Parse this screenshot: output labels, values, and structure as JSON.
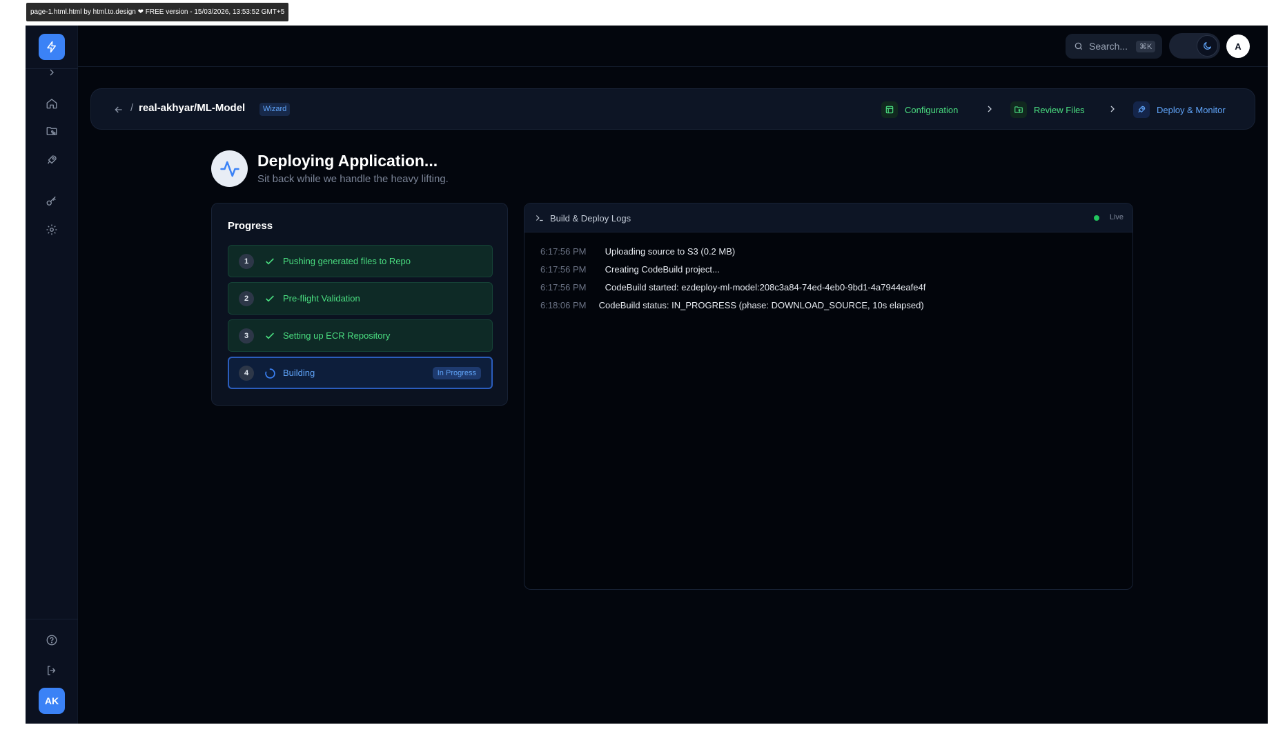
{
  "watermark": "page-1.html.html by html.to.design ❤ FREE version - 15/03/2026, 13:53:52 GMT+5",
  "topbar": {
    "search_placeholder": "Search...",
    "search_shortcut": "⌘K",
    "user_initial": "A"
  },
  "sidebar": {
    "items": [
      {
        "name": "expand",
        "icon": "chevron-right-icon"
      },
      {
        "name": "home",
        "icon": "home-icon"
      },
      {
        "name": "repositories",
        "icon": "folder-git-icon"
      },
      {
        "name": "deployments",
        "icon": "rocket-icon"
      },
      {
        "name": "keys",
        "icon": "key-icon"
      },
      {
        "name": "settings",
        "icon": "gear-icon"
      },
      {
        "name": "help",
        "icon": "help-circle-icon"
      },
      {
        "name": "logout",
        "icon": "logout-icon"
      }
    ],
    "avatar_initials": "AK"
  },
  "wizard": {
    "slash": "/",
    "repo": "real-akhyar/ML-Model",
    "badge": "Wizard",
    "steps": [
      {
        "label": "Configuration",
        "icon": "layout-icon",
        "state": "done"
      },
      {
        "label": "Review Files",
        "icon": "folder-git-icon",
        "state": "done"
      },
      {
        "label": "Deploy & Monitor",
        "icon": "rocket-icon",
        "state": "active"
      }
    ]
  },
  "header": {
    "title": "Deploying Application...",
    "subtitle": "Sit back while we handle the heavy lifting."
  },
  "progress": {
    "title": "Progress",
    "items": [
      {
        "num": "1",
        "label": "Pushing generated files to Repo",
        "status": "done"
      },
      {
        "num": "2",
        "label": "Pre-flight Validation",
        "status": "done"
      },
      {
        "num": "3",
        "label": "Setting up ECR Repository",
        "status": "done"
      },
      {
        "num": "4",
        "label": "Building",
        "status": "active",
        "badge": "In Progress"
      }
    ]
  },
  "logs": {
    "title": "Build & Deploy Logs",
    "live_label": "Live",
    "lines": [
      {
        "time": "6:17:56 PM",
        "message": "Uploading source to S3 (0.2 MB)"
      },
      {
        "time": "6:17:56 PM",
        "message": "Creating CodeBuild project..."
      },
      {
        "time": "6:17:56 PM",
        "message": "CodeBuild started: ezdeploy-ml-model:208c3a84-74ed-4eb0-9bd1-4a7944eafe4f"
      },
      {
        "time": "6:18:06 PM",
        "message": "CodeBuild status: IN_PROGRESS (phase: DOWNLOAD_SOURCE, 10s elapsed)"
      }
    ]
  },
  "colors": {
    "accent": "#3b82f6",
    "success": "#4ade80",
    "background": "#03060d",
    "live": "#22c55e"
  }
}
